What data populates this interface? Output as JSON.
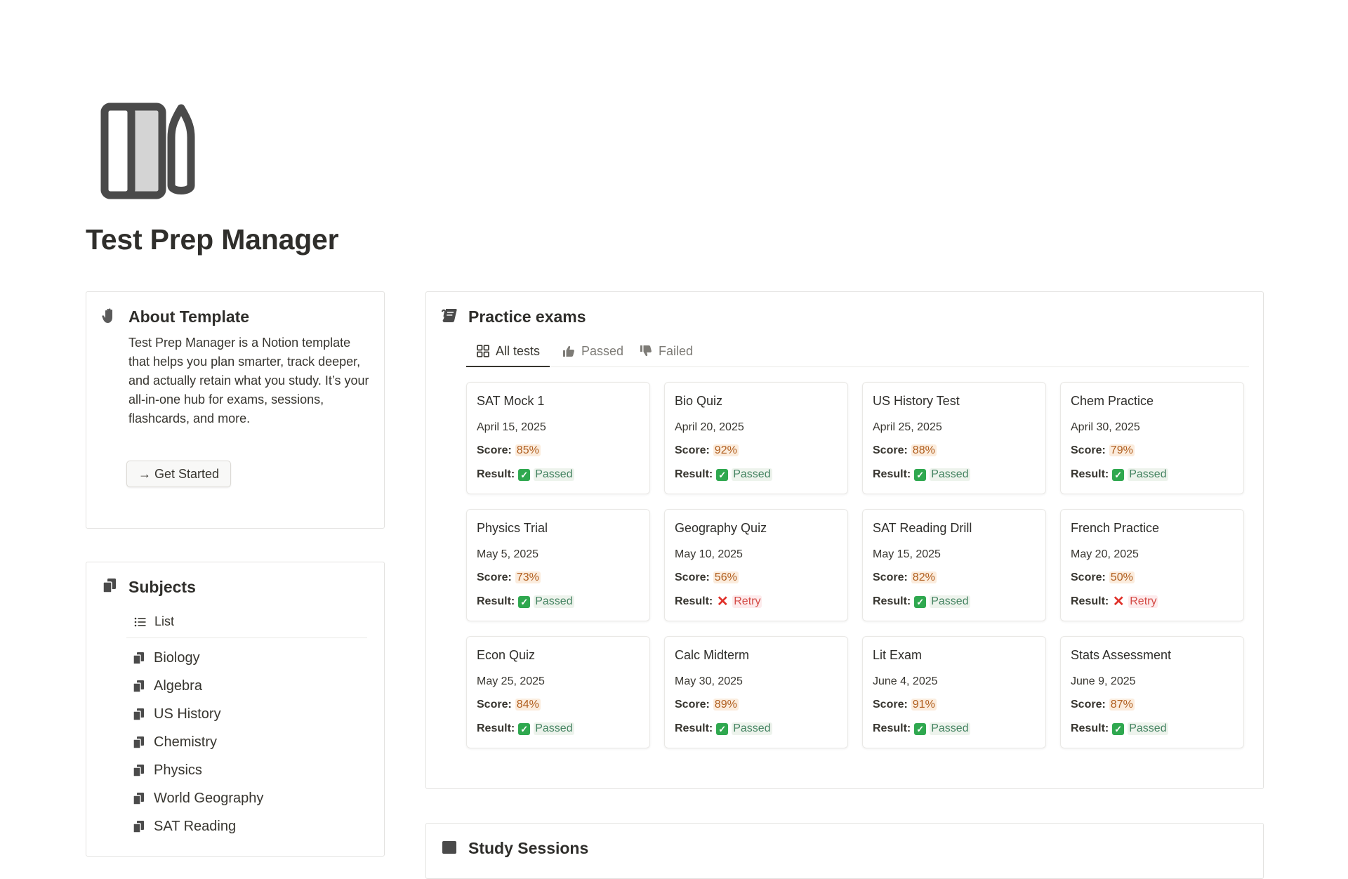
{
  "page": {
    "title": "Test Prep Manager",
    "icon": "notebook-pencil-icon"
  },
  "about": {
    "icon": "hand-icon",
    "title": "About Template",
    "text": "Test Prep Manager is a Notion template that helps you plan smarter, track deeper, and actually retain what you study. It’s your all-in-one hub for exams, sessions, flashcards, and more.",
    "button_label": "→ Get Started"
  },
  "exams": {
    "icon": "scroll-icon",
    "title": "Practice exams",
    "tabs": [
      {
        "label": "All tests",
        "icon": "gallery-grid-icon"
      },
      {
        "label": "Passed",
        "icon": "thumbs-up-icon"
      },
      {
        "label": "Failed",
        "icon": "thumbs-down-icon"
      }
    ],
    "score_label": "Score:",
    "result_label": "Result:",
    "cards": [
      {
        "title": "SAT Mock 1",
        "date": "April 15, 2025",
        "score": "85%",
        "result": "Passed",
        "passed": true
      },
      {
        "title": "Bio Quiz",
        "date": "April 20, 2025",
        "score": "92%",
        "result": "Passed",
        "passed": true
      },
      {
        "title": "US History Test",
        "date": "April 25, 2025",
        "score": "88%",
        "result": "Passed",
        "passed": true
      },
      {
        "title": "Chem Practice",
        "date": "April 30, 2025",
        "score": "79%",
        "result": "Passed",
        "passed": true
      },
      {
        "title": "Physics Trial",
        "date": "May 5, 2025",
        "score": "73%",
        "result": "Passed",
        "passed": true
      },
      {
        "title": "Geography Quiz",
        "date": "May 10, 2025",
        "score": "56%",
        "result": "Retry",
        "passed": false
      },
      {
        "title": "SAT Reading Drill",
        "date": "May 15, 2025",
        "score": "82%",
        "result": "Passed",
        "passed": true
      },
      {
        "title": "French Practice",
        "date": "May 20, 2025",
        "score": "50%",
        "result": "Retry",
        "passed": false
      },
      {
        "title": "Econ Quiz",
        "date": "May 25, 2025",
        "score": "84%",
        "result": "Passed",
        "passed": true
      },
      {
        "title": "Calc Midterm",
        "date": "May 30, 2025",
        "score": "89%",
        "result": "Passed",
        "passed": true
      },
      {
        "title": "Lit Exam",
        "date": "June 4, 2025",
        "score": "91%",
        "result": "Passed",
        "passed": true
      },
      {
        "title": "Stats Assessment",
        "date": "June 9, 2025",
        "score": "87%",
        "result": "Passed",
        "passed": true
      }
    ]
  },
  "subjects": {
    "icon": "pages-icon",
    "title": "Subjects",
    "view_label": "List",
    "items": [
      "Biology",
      "Algebra",
      "US History",
      "Chemistry",
      "Physics",
      "World Geography",
      "SAT Reading"
    ]
  },
  "sessions": {
    "title": "Study Sessions"
  },
  "colors": {
    "text": "#37352f",
    "score_bg": "#fbecdd",
    "score_text": "#b05e1e",
    "pass_text": "#448361",
    "fail_text": "#d44c47"
  }
}
